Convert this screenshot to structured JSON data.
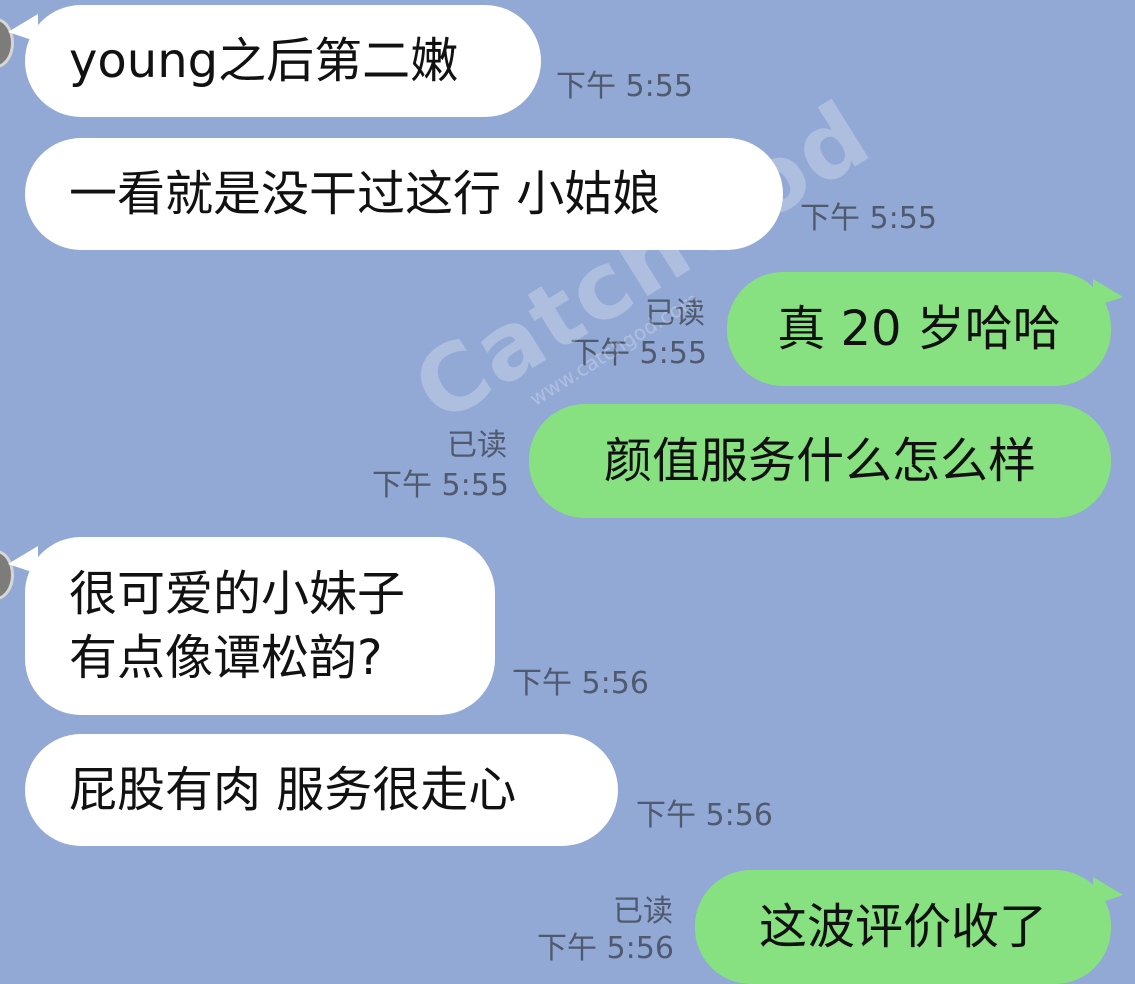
{
  "messages": [
    {
      "direction": "in",
      "text": "young之后第二嫩",
      "time": "下午 5:55"
    },
    {
      "direction": "in",
      "text": "一看就是没干过这行 小姑娘",
      "time": "下午 5:55"
    },
    {
      "direction": "out",
      "text": "真 20 岁哈哈",
      "time": "下午 5:55",
      "read": "已读"
    },
    {
      "direction": "out",
      "text": "颜值服务什么怎么样",
      "time": "下午 5:55",
      "read": "已读"
    },
    {
      "direction": "in",
      "text": "很可爱的小妹子\n有点像谭松韵?",
      "time": "下午 5:56"
    },
    {
      "direction": "in",
      "text": "屁股有肉 服务很走心",
      "time": "下午 5:56"
    },
    {
      "direction": "out",
      "text": "这波评价收了",
      "time": "下午 5:56",
      "read": "已读"
    }
  ],
  "watermark": {
    "main": "CatchGod",
    "sub": "www.catchgod.com"
  },
  "colors": {
    "background": "#93a9d5",
    "incoming_bubble": "#ffffff",
    "outgoing_bubble": "#88e180",
    "meta_text": "#4f5a6e"
  }
}
